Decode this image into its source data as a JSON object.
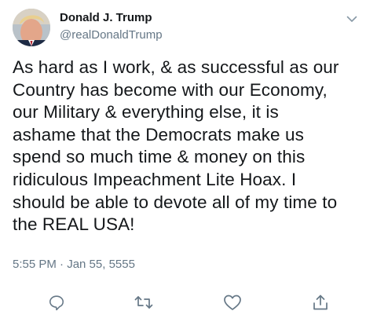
{
  "tweet": {
    "author": {
      "display_name": "Donald J. Trump",
      "handle": "@realDonaldTrump"
    },
    "text": "As hard as I work, & as successful as our\nCountry has become with our Economy,\nour Military & everything else, it is\nashame that the Democrats make us\nspend so much time & money on this\nridiculous Impeachment Lite Hoax. I\nshould be able to devote all of my time to\nthe REAL USA!",
    "timestamp": "5:55 PM · Jan 55, 5555"
  },
  "icons": {
    "caret": "chevron-down-icon",
    "reply": "reply-icon",
    "retweet": "retweet-icon",
    "like": "heart-icon",
    "share": "share-icon"
  },
  "colors": {
    "text": "#14171a",
    "secondary": "#657786",
    "icon": "#657786"
  }
}
